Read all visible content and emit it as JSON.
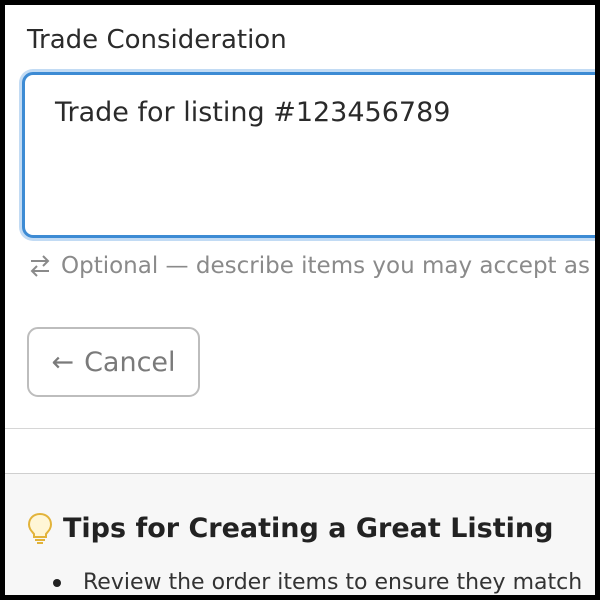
{
  "form": {
    "label": "Trade Consideration",
    "textarea_value": "Trade for listing #123456789",
    "helper_text": "Optional — describe items you may accept as t",
    "helper_icon": "swap-arrows-icon"
  },
  "actions": {
    "cancel_label": "Cancel",
    "cancel_icon": "arrow-left-icon"
  },
  "tips": {
    "icon": "lightbulb-icon",
    "title": "Tips for Creating a Great Listing",
    "items": [
      "Review the order items to ensure they match"
    ]
  },
  "colors": {
    "focus_border": "#3d8bd4",
    "lightbulb": "#f2c94c"
  }
}
